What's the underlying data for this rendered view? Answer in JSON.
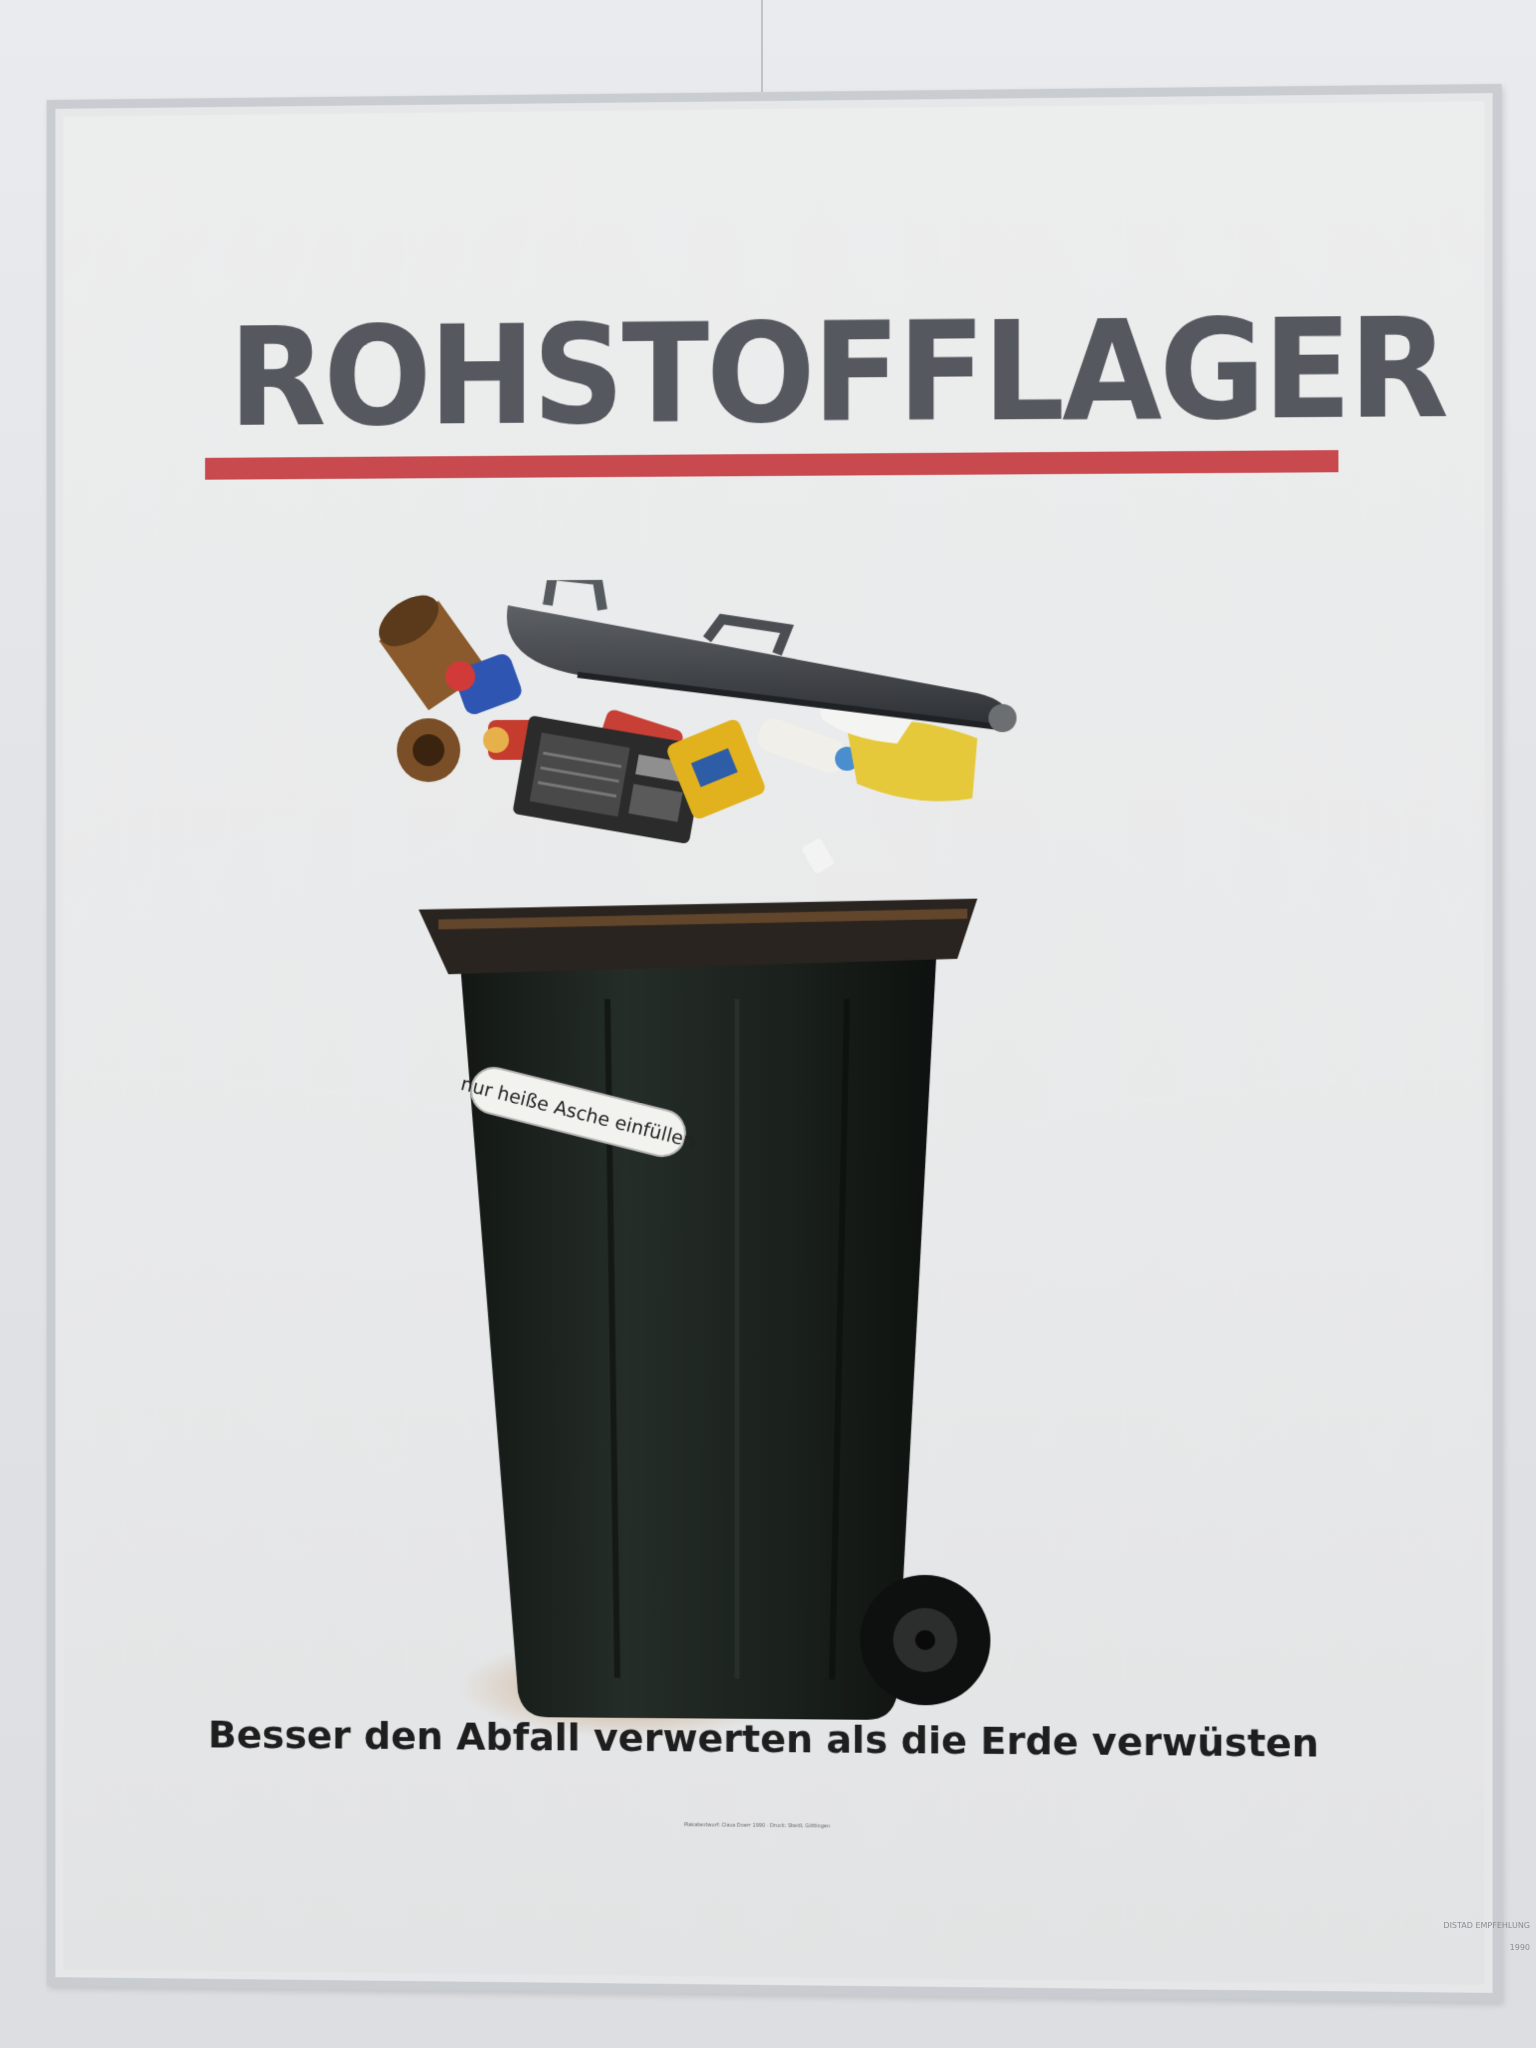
{
  "poster": {
    "headline": "ROHSTOFFLAGER",
    "bin_sticker_text": "nur heiße Asche einfüllen",
    "tagline": "Besser den Abfall verwerten als die Erde verwüsten",
    "credit": "Plakatentwurf: Claus Doerr 1990 · Druck: Steidl, Göttingen"
  },
  "wall_label": {
    "line1": "DISTAD EMPFEHLUNG",
    "line2": "1990"
  },
  "colors": {
    "headline": "#55585f",
    "rule": "#c84a4f",
    "tagline": "#1e1e1e",
    "bin": "#1c231f",
    "frame": "#c9ccd0",
    "wall": "#e4e6ea"
  },
  "image": {
    "subject": "overfilled-wheelie-bin"
  }
}
